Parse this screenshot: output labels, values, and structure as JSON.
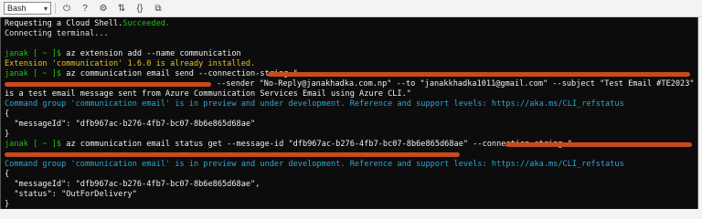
{
  "toolbar": {
    "shell_type": "Bash",
    "icons": [
      "power-icon",
      "help-icon",
      "settings-icon",
      "upload-download-icon",
      "braces-icon",
      "web-preview-icon"
    ],
    "icon_glyphs": [
      "⏻",
      "?",
      "⚙",
      "⇅",
      "{}",
      "⧉"
    ]
  },
  "terminal": {
    "l1a": "Requesting a Cloud Shell.",
    "l1b": "Succeeded.",
    "l2": "Connecting terminal...",
    "prompt": "janak [ ~ ]$ ",
    "cmd1": "az extension add --name communication",
    "warn1": "Extension 'communication' 1.6.0 is already installed.",
    "cmd2": "az communication email send --connection-string \"",
    "cmd2b": "--sender \"No-Reply@janakhadka.com.np\" --to \"janakkhadka1011@gmail.com\" --subject \"Test Email #TE2023\" --text \"This",
    "cmd2c": "is a test email message sent from Azure Communication Services Email using Azure CLI.\"",
    "info1": "Command group 'communication email' is in preview and under development. Reference and support levels: https://aka.ms/CLI_refstatus",
    "brace_open": "{",
    "msgid1": "  \"messageId\": \"dfb967ac-b276-4fb7-bc07-8b6e865d68ae\"",
    "brace_close": "}",
    "cmd3": "az communication email status get --message-id \"dfb967ac-b276-4fb7-bc07-8b6e865d68ae\" --connection-string \"",
    "info2": "Command group 'communication email' is in preview and under development. Reference and support levels: https://aka.ms/CLI_refstatus",
    "msgid2": "  \"messageId\": \"dfb967ac-b276-4fb7-bc07-8b6e865d68ae\",",
    "status": "  \"status\": \"OutForDelivery\""
  },
  "colors": {
    "background": "#0c0c0c",
    "prompt": "#16c60c",
    "info": "#2aa7d6",
    "warning": "#e8c21a",
    "redaction": "#c94a1d"
  }
}
